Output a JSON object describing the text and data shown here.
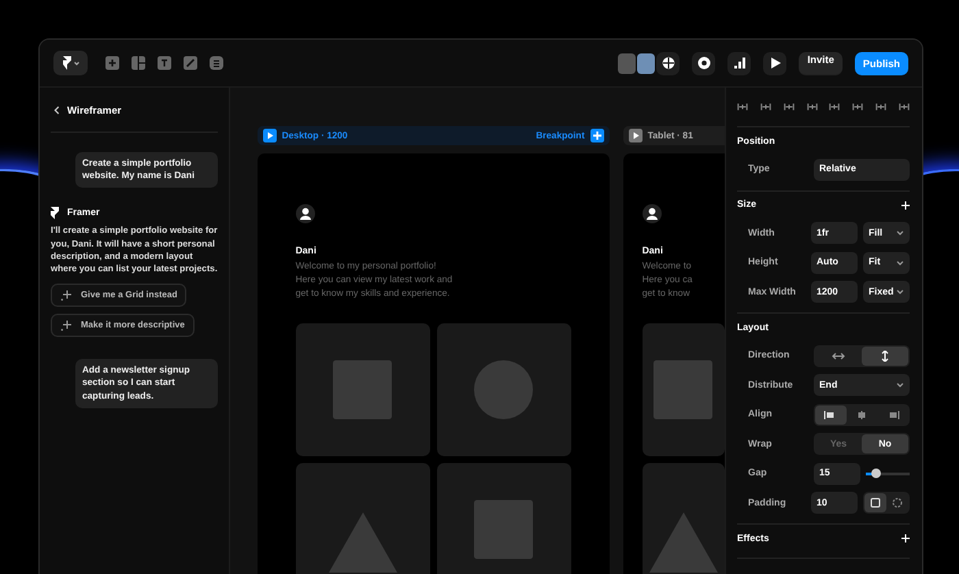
{
  "toolbar": {
    "buttons": [
      {
        "label": "Invite",
        "kind": "secondary"
      },
      {
        "label": "Publish",
        "kind": "primary"
      }
    ]
  },
  "chat": {
    "title": "Wireframer",
    "messages": [
      {
        "kind": "prompt",
        "text": "Create a simple portfolio website. My name is Dani"
      },
      {
        "kind": "reply",
        "author": "Framer",
        "text": "I'll create a simple portfolio website for you, Dani. It will have a short personal description, and a modern layout where you can list your latest projects.",
        "suggestions": [
          "Give me a Grid instead",
          "Make it more descriptive"
        ]
      },
      {
        "kind": "prompt",
        "text": "Add a newsletter signup section so I can start capturing leads."
      }
    ]
  },
  "canvas": {
    "frames": [
      {
        "label": "Desktop · 1200",
        "selected": true,
        "action": "Breakpoint",
        "site": {
          "name": "Dani",
          "lines": [
            "Welcome to my personal portfolio!",
            "Here you can view my latest work and",
            "get to know my skills and experience."
          ]
        },
        "tiles": [
          {
            "kind": "square"
          },
          {
            "kind": "circle"
          },
          {
            "kind": "triangle"
          },
          {
            "kind": "square"
          }
        ]
      },
      {
        "label": "Tablet · 81",
        "selected": false,
        "site": {
          "name": "Dani",
          "lines": [
            "Welcome to",
            "Here you ca",
            "get to know"
          ]
        },
        "tiles": [
          {
            "kind": "square"
          },
          {
            "kind": "triangle"
          }
        ]
      }
    ]
  },
  "inspector": {
    "sections": [
      {
        "title": "Position",
        "add": false,
        "rows": [
          {
            "kind": "field",
            "label": "Type",
            "value": "Relative"
          }
        ]
      },
      {
        "title": "Size",
        "add": true,
        "rows": [
          {
            "kind": "field-select",
            "label": "Width",
            "value": "1fr",
            "option": "Fill"
          },
          {
            "kind": "field-select",
            "label": "Height",
            "value": "Auto",
            "option": "Fit"
          },
          {
            "kind": "field-select",
            "label": "Max Width",
            "value": "1200",
            "option": "Fixed"
          }
        ]
      },
      {
        "title": "Layout",
        "add": false,
        "rows": [
          {
            "kind": "direction",
            "label": "Direction",
            "options": [
              {
                "selected": false
              },
              {
                "selected": true
              }
            ]
          },
          {
            "kind": "dropdown",
            "label": "Distribute",
            "value": "End"
          },
          {
            "kind": "align",
            "label": "Align",
            "options": [
              {
                "selected": true
              },
              {
                "selected": false
              },
              {
                "selected": false
              }
            ]
          },
          {
            "kind": "text-toggle",
            "label": "Wrap",
            "options": [
              {
                "text": "Yes",
                "selected": false
              },
              {
                "text": "No",
                "selected": true
              }
            ]
          },
          {
            "kind": "slider",
            "label": "Gap",
            "value": "15",
            "level": 0.22
          },
          {
            "kind": "padding",
            "label": "Padding",
            "value": "10",
            "options": [
              {
                "selected": true
              },
              {
                "selected": false
              }
            ]
          }
        ]
      },
      {
        "title": "Effects",
        "add": true
      }
    ]
  }
}
